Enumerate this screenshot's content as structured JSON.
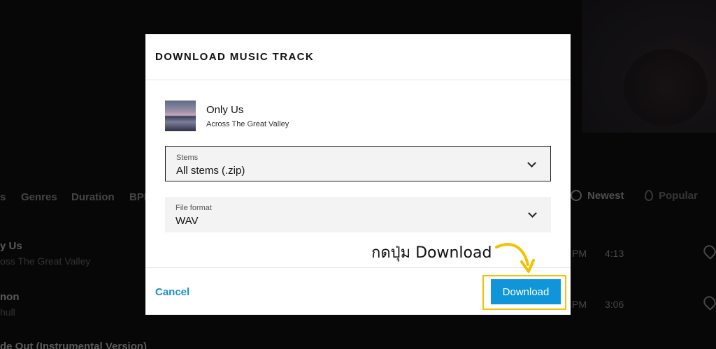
{
  "background": {
    "filters": [
      "s",
      "Genres",
      "Duration",
      "BPI"
    ],
    "sort": {
      "newest": "Newest",
      "popular": "Popular"
    },
    "rows": [
      {
        "title": "y Us",
        "subtitle": "oss The Great Valley",
        "time": "PM",
        "duration": "4:13"
      },
      {
        "title": "non",
        "subtitle": "hull",
        "time": "PM",
        "duration": "3:06"
      },
      {
        "title": "de Out (Instrumental Version)"
      }
    ]
  },
  "modal": {
    "title": "DOWNLOAD MUSIC TRACK",
    "track": {
      "name": "Only Us",
      "artist": "Across The Great Valley"
    },
    "stems": {
      "label": "Stems",
      "value": "All stems (.zip)"
    },
    "format": {
      "label": "File format",
      "value": "WAV"
    },
    "cancel_label": "Cancel",
    "download_label": "Download"
  },
  "annotation": {
    "text": "กดปุ่ม Download",
    "color": "#f2c200"
  },
  "colors": {
    "accent": "#0f95d8",
    "link": "#1a8fd1",
    "highlight": "#f2c200"
  },
  "icons": {
    "sort_newest": "clock-icon",
    "sort_popular": "flame-icon",
    "dropdown": "chevron-down-icon",
    "favorite": "heart-icon"
  }
}
